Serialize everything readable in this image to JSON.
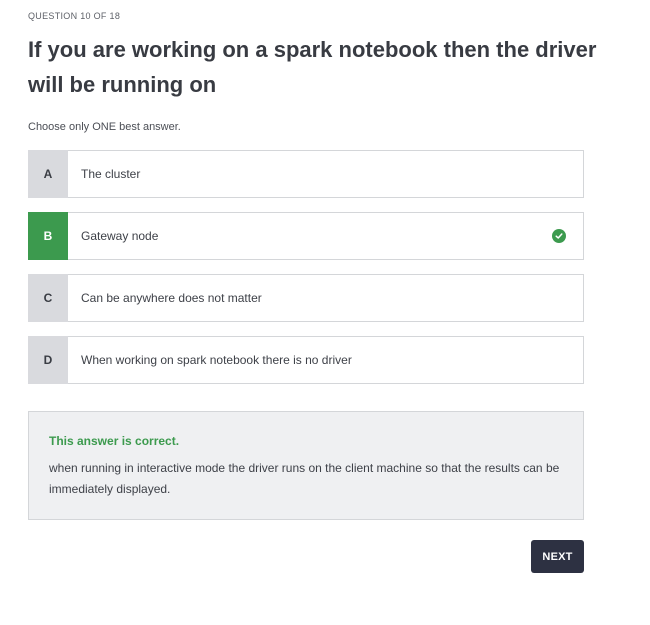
{
  "quiz": {
    "counter": "QUESTION 10 OF 18",
    "question": "If you are working on a spark notebook then the driver will be running on",
    "instruction": "Choose only ONE best answer."
  },
  "options": [
    {
      "letter": "A",
      "text": "The cluster",
      "correct": false
    },
    {
      "letter": "B",
      "text": "Gateway node",
      "correct": true,
      "selected": true
    },
    {
      "letter": "C",
      "text": "Can be anywhere does not matter",
      "correct": false
    },
    {
      "letter": "D",
      "text": "When working on spark notebook there is no driver",
      "correct": false
    }
  ],
  "feedback": {
    "status": "This answer is correct.",
    "explanation": "when running in interactive mode the driver runs on the client machine so that the results can be immediately displayed."
  },
  "buttons": {
    "next_label": "NEXT"
  },
  "icons": {
    "correct_mark": "check-circle-icon"
  },
  "colors": {
    "correct_green": "#3c9a4e",
    "button_dark": "#2d3142",
    "letter_grey": "#d9dade",
    "feedback_bg": "#eff0f2"
  }
}
